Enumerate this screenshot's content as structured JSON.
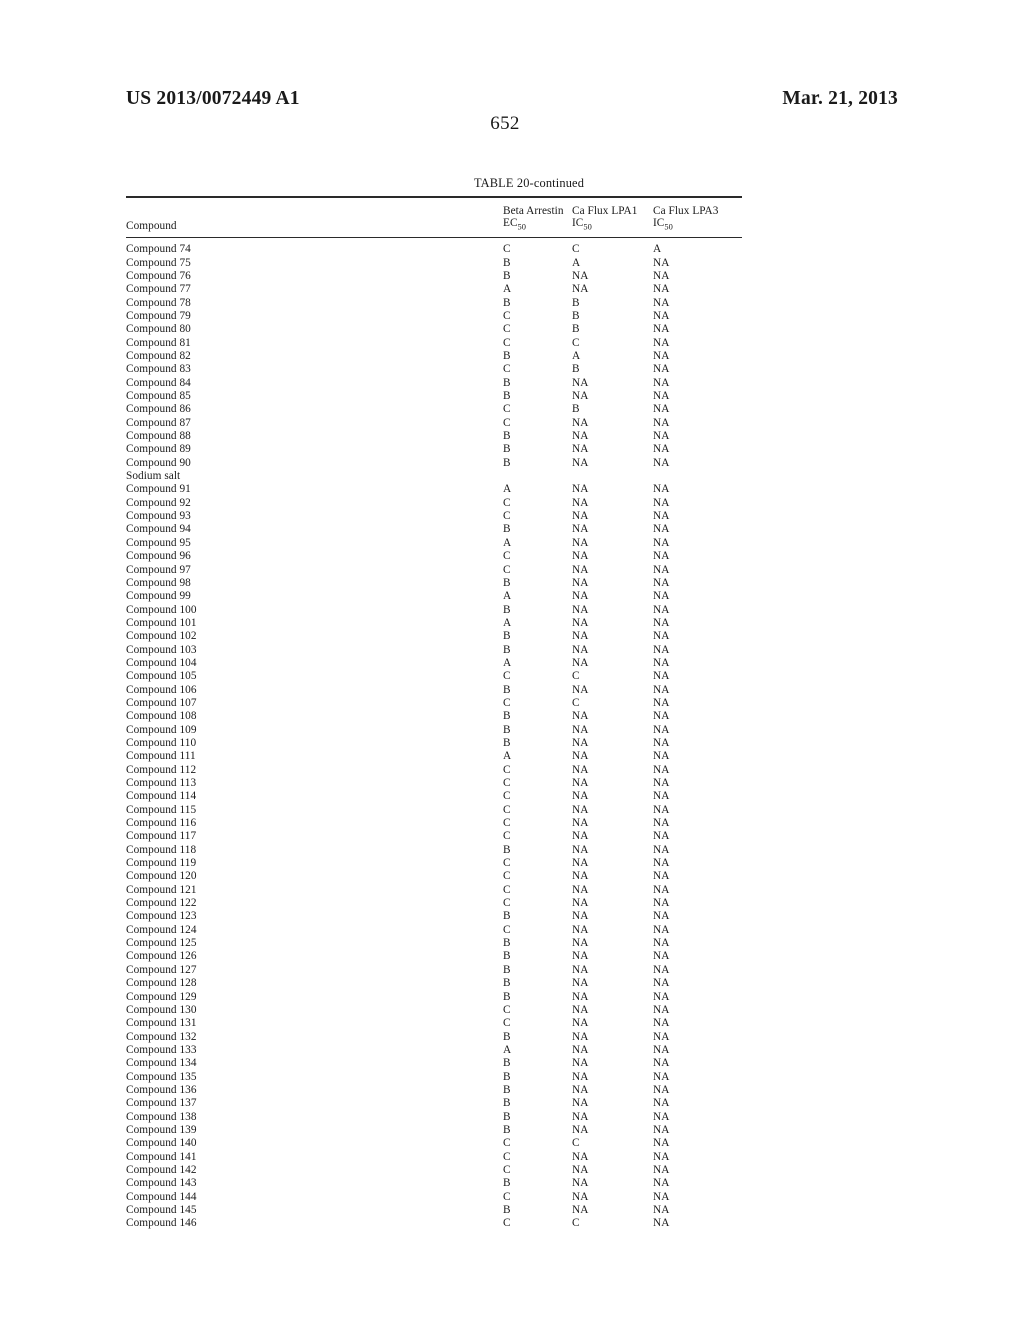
{
  "header": {
    "publication_number": "US 2013/0072449 A1",
    "publication_date": "Mar. 21, 2013",
    "page_number": "652"
  },
  "table": {
    "caption": "TABLE 20-continued",
    "columns": [
      {
        "line1": "Compound",
        "line2": ""
      },
      {
        "line1": "Beta Arrestin",
        "line2": "EC",
        "sub": "50"
      },
      {
        "line1": "Ca Flux LPA1",
        "line2": "IC",
        "sub": "50"
      },
      {
        "line1": "Ca Flux LPA3",
        "line2": "IC",
        "sub": "50"
      }
    ],
    "rows": [
      {
        "compound": "Compound 74",
        "beta_arrestin_ec50": "C",
        "ca_flux_lpa1_ic50": "C",
        "ca_flux_lpa3_ic50": "A"
      },
      {
        "compound": "Compound 75",
        "beta_arrestin_ec50": "B",
        "ca_flux_lpa1_ic50": "A",
        "ca_flux_lpa3_ic50": "NA"
      },
      {
        "compound": "Compound 76",
        "beta_arrestin_ec50": "B",
        "ca_flux_lpa1_ic50": "NA",
        "ca_flux_lpa3_ic50": "NA"
      },
      {
        "compound": "Compound 77",
        "beta_arrestin_ec50": "A",
        "ca_flux_lpa1_ic50": "NA",
        "ca_flux_lpa3_ic50": "NA"
      },
      {
        "compound": "Compound 78",
        "beta_arrestin_ec50": "B",
        "ca_flux_lpa1_ic50": "B",
        "ca_flux_lpa3_ic50": "NA"
      },
      {
        "compound": "Compound 79",
        "beta_arrestin_ec50": "C",
        "ca_flux_lpa1_ic50": "B",
        "ca_flux_lpa3_ic50": "NA"
      },
      {
        "compound": "Compound 80",
        "beta_arrestin_ec50": "C",
        "ca_flux_lpa1_ic50": "B",
        "ca_flux_lpa3_ic50": "NA"
      },
      {
        "compound": "Compound 81",
        "beta_arrestin_ec50": "C",
        "ca_flux_lpa1_ic50": "C",
        "ca_flux_lpa3_ic50": "NA"
      },
      {
        "compound": "Compound 82",
        "beta_arrestin_ec50": "B",
        "ca_flux_lpa1_ic50": "A",
        "ca_flux_lpa3_ic50": "NA"
      },
      {
        "compound": "Compound 83",
        "beta_arrestin_ec50": "C",
        "ca_flux_lpa1_ic50": "B",
        "ca_flux_lpa3_ic50": "NA"
      },
      {
        "compound": "Compound 84",
        "beta_arrestin_ec50": "B",
        "ca_flux_lpa1_ic50": "NA",
        "ca_flux_lpa3_ic50": "NA"
      },
      {
        "compound": "Compound 85",
        "beta_arrestin_ec50": "B",
        "ca_flux_lpa1_ic50": "NA",
        "ca_flux_lpa3_ic50": "NA"
      },
      {
        "compound": "Compound 86",
        "beta_arrestin_ec50": "C",
        "ca_flux_lpa1_ic50": "B",
        "ca_flux_lpa3_ic50": "NA"
      },
      {
        "compound": "Compound 87",
        "beta_arrestin_ec50": "C",
        "ca_flux_lpa1_ic50": "NA",
        "ca_flux_lpa3_ic50": "NA"
      },
      {
        "compound": "Compound 88",
        "beta_arrestin_ec50": "B",
        "ca_flux_lpa1_ic50": "NA",
        "ca_flux_lpa3_ic50": "NA"
      },
      {
        "compound": "Compound 89",
        "beta_arrestin_ec50": "B",
        "ca_flux_lpa1_ic50": "NA",
        "ca_flux_lpa3_ic50": "NA"
      },
      {
        "compound": "Compound 90",
        "beta_arrestin_ec50": "B",
        "ca_flux_lpa1_ic50": "NA",
        "ca_flux_lpa3_ic50": "NA"
      },
      {
        "compound": "Sodium salt",
        "beta_arrestin_ec50": "",
        "ca_flux_lpa1_ic50": "",
        "ca_flux_lpa3_ic50": ""
      },
      {
        "compound": "Compound 91",
        "beta_arrestin_ec50": "A",
        "ca_flux_lpa1_ic50": "NA",
        "ca_flux_lpa3_ic50": "NA"
      },
      {
        "compound": "Compound 92",
        "beta_arrestin_ec50": "C",
        "ca_flux_lpa1_ic50": "NA",
        "ca_flux_lpa3_ic50": "NA"
      },
      {
        "compound": "Compound 93",
        "beta_arrestin_ec50": "C",
        "ca_flux_lpa1_ic50": "NA",
        "ca_flux_lpa3_ic50": "NA"
      },
      {
        "compound": "Compound 94",
        "beta_arrestin_ec50": "B",
        "ca_flux_lpa1_ic50": "NA",
        "ca_flux_lpa3_ic50": "NA"
      },
      {
        "compound": "Compound 95",
        "beta_arrestin_ec50": "A",
        "ca_flux_lpa1_ic50": "NA",
        "ca_flux_lpa3_ic50": "NA"
      },
      {
        "compound": "Compound 96",
        "beta_arrestin_ec50": "C",
        "ca_flux_lpa1_ic50": "NA",
        "ca_flux_lpa3_ic50": "NA"
      },
      {
        "compound": "Compound 97",
        "beta_arrestin_ec50": "C",
        "ca_flux_lpa1_ic50": "NA",
        "ca_flux_lpa3_ic50": "NA"
      },
      {
        "compound": "Compound 98",
        "beta_arrestin_ec50": "B",
        "ca_flux_lpa1_ic50": "NA",
        "ca_flux_lpa3_ic50": "NA"
      },
      {
        "compound": "Compound 99",
        "beta_arrestin_ec50": "A",
        "ca_flux_lpa1_ic50": "NA",
        "ca_flux_lpa3_ic50": "NA"
      },
      {
        "compound": "Compound 100",
        "beta_arrestin_ec50": "B",
        "ca_flux_lpa1_ic50": "NA",
        "ca_flux_lpa3_ic50": "NA"
      },
      {
        "compound": "Compound 101",
        "beta_arrestin_ec50": "A",
        "ca_flux_lpa1_ic50": "NA",
        "ca_flux_lpa3_ic50": "NA"
      },
      {
        "compound": "Compound 102",
        "beta_arrestin_ec50": "B",
        "ca_flux_lpa1_ic50": "NA",
        "ca_flux_lpa3_ic50": "NA"
      },
      {
        "compound": "Compound 103",
        "beta_arrestin_ec50": "B",
        "ca_flux_lpa1_ic50": "NA",
        "ca_flux_lpa3_ic50": "NA"
      },
      {
        "compound": "Compound 104",
        "beta_arrestin_ec50": "A",
        "ca_flux_lpa1_ic50": "NA",
        "ca_flux_lpa3_ic50": "NA"
      },
      {
        "compound": "Compound 105",
        "beta_arrestin_ec50": "C",
        "ca_flux_lpa1_ic50": "C",
        "ca_flux_lpa3_ic50": "NA"
      },
      {
        "compound": "Compound 106",
        "beta_arrestin_ec50": "B",
        "ca_flux_lpa1_ic50": "NA",
        "ca_flux_lpa3_ic50": "NA"
      },
      {
        "compound": "Compound 107",
        "beta_arrestin_ec50": "C",
        "ca_flux_lpa1_ic50": "C",
        "ca_flux_lpa3_ic50": "NA"
      },
      {
        "compound": "Compound 108",
        "beta_arrestin_ec50": "B",
        "ca_flux_lpa1_ic50": "NA",
        "ca_flux_lpa3_ic50": "NA"
      },
      {
        "compound": "Compound 109",
        "beta_arrestin_ec50": "B",
        "ca_flux_lpa1_ic50": "NA",
        "ca_flux_lpa3_ic50": "NA"
      },
      {
        "compound": "Compound 110",
        "beta_arrestin_ec50": "B",
        "ca_flux_lpa1_ic50": "NA",
        "ca_flux_lpa3_ic50": "NA"
      },
      {
        "compound": "Compound 111",
        "beta_arrestin_ec50": "A",
        "ca_flux_lpa1_ic50": "NA",
        "ca_flux_lpa3_ic50": "NA"
      },
      {
        "compound": "Compound 112",
        "beta_arrestin_ec50": "C",
        "ca_flux_lpa1_ic50": "NA",
        "ca_flux_lpa3_ic50": "NA"
      },
      {
        "compound": "Compound 113",
        "beta_arrestin_ec50": "C",
        "ca_flux_lpa1_ic50": "NA",
        "ca_flux_lpa3_ic50": "NA"
      },
      {
        "compound": "Compound 114",
        "beta_arrestin_ec50": "C",
        "ca_flux_lpa1_ic50": "NA",
        "ca_flux_lpa3_ic50": "NA"
      },
      {
        "compound": "Compound 115",
        "beta_arrestin_ec50": "C",
        "ca_flux_lpa1_ic50": "NA",
        "ca_flux_lpa3_ic50": "NA"
      },
      {
        "compound": "Compound 116",
        "beta_arrestin_ec50": "C",
        "ca_flux_lpa1_ic50": "NA",
        "ca_flux_lpa3_ic50": "NA"
      },
      {
        "compound": "Compound 117",
        "beta_arrestin_ec50": "C",
        "ca_flux_lpa1_ic50": "NA",
        "ca_flux_lpa3_ic50": "NA"
      },
      {
        "compound": "Compound 118",
        "beta_arrestin_ec50": "B",
        "ca_flux_lpa1_ic50": "NA",
        "ca_flux_lpa3_ic50": "NA"
      },
      {
        "compound": "Compound 119",
        "beta_arrestin_ec50": "C",
        "ca_flux_lpa1_ic50": "NA",
        "ca_flux_lpa3_ic50": "NA"
      },
      {
        "compound": "Compound 120",
        "beta_arrestin_ec50": "C",
        "ca_flux_lpa1_ic50": "NA",
        "ca_flux_lpa3_ic50": "NA"
      },
      {
        "compound": "Compound 121",
        "beta_arrestin_ec50": "C",
        "ca_flux_lpa1_ic50": "NA",
        "ca_flux_lpa3_ic50": "NA"
      },
      {
        "compound": "Compound 122",
        "beta_arrestin_ec50": "C",
        "ca_flux_lpa1_ic50": "NA",
        "ca_flux_lpa3_ic50": "NA"
      },
      {
        "compound": "Compound 123",
        "beta_arrestin_ec50": "B",
        "ca_flux_lpa1_ic50": "NA",
        "ca_flux_lpa3_ic50": "NA"
      },
      {
        "compound": "Compound 124",
        "beta_arrestin_ec50": "C",
        "ca_flux_lpa1_ic50": "NA",
        "ca_flux_lpa3_ic50": "NA"
      },
      {
        "compound": "Compound 125",
        "beta_arrestin_ec50": "B",
        "ca_flux_lpa1_ic50": "NA",
        "ca_flux_lpa3_ic50": "NA"
      },
      {
        "compound": "Compound 126",
        "beta_arrestin_ec50": "B",
        "ca_flux_lpa1_ic50": "NA",
        "ca_flux_lpa3_ic50": "NA"
      },
      {
        "compound": "Compound 127",
        "beta_arrestin_ec50": "B",
        "ca_flux_lpa1_ic50": "NA",
        "ca_flux_lpa3_ic50": "NA"
      },
      {
        "compound": "Compound 128",
        "beta_arrestin_ec50": "B",
        "ca_flux_lpa1_ic50": "NA",
        "ca_flux_lpa3_ic50": "NA"
      },
      {
        "compound": "Compound 129",
        "beta_arrestin_ec50": "B",
        "ca_flux_lpa1_ic50": "NA",
        "ca_flux_lpa3_ic50": "NA"
      },
      {
        "compound": "Compound 130",
        "beta_arrestin_ec50": "C",
        "ca_flux_lpa1_ic50": "NA",
        "ca_flux_lpa3_ic50": "NA"
      },
      {
        "compound": "Compound 131",
        "beta_arrestin_ec50": "C",
        "ca_flux_lpa1_ic50": "NA",
        "ca_flux_lpa3_ic50": "NA"
      },
      {
        "compound": "Compound 132",
        "beta_arrestin_ec50": "B",
        "ca_flux_lpa1_ic50": "NA",
        "ca_flux_lpa3_ic50": "NA"
      },
      {
        "compound": "Compound 133",
        "beta_arrestin_ec50": "A",
        "ca_flux_lpa1_ic50": "NA",
        "ca_flux_lpa3_ic50": "NA"
      },
      {
        "compound": "Compound 134",
        "beta_arrestin_ec50": "B",
        "ca_flux_lpa1_ic50": "NA",
        "ca_flux_lpa3_ic50": "NA"
      },
      {
        "compound": "Compound 135",
        "beta_arrestin_ec50": "B",
        "ca_flux_lpa1_ic50": "NA",
        "ca_flux_lpa3_ic50": "NA"
      },
      {
        "compound": "Compound 136",
        "beta_arrestin_ec50": "B",
        "ca_flux_lpa1_ic50": "NA",
        "ca_flux_lpa3_ic50": "NA"
      },
      {
        "compound": "Compound 137",
        "beta_arrestin_ec50": "B",
        "ca_flux_lpa1_ic50": "NA",
        "ca_flux_lpa3_ic50": "NA"
      },
      {
        "compound": "Compound 138",
        "beta_arrestin_ec50": "B",
        "ca_flux_lpa1_ic50": "NA",
        "ca_flux_lpa3_ic50": "NA"
      },
      {
        "compound": "Compound 139",
        "beta_arrestin_ec50": "B",
        "ca_flux_lpa1_ic50": "NA",
        "ca_flux_lpa3_ic50": "NA"
      },
      {
        "compound": "Compound 140",
        "beta_arrestin_ec50": "C",
        "ca_flux_lpa1_ic50": "C",
        "ca_flux_lpa3_ic50": "NA"
      },
      {
        "compound": "Compound 141",
        "beta_arrestin_ec50": "C",
        "ca_flux_lpa1_ic50": "NA",
        "ca_flux_lpa3_ic50": "NA"
      },
      {
        "compound": "Compound 142",
        "beta_arrestin_ec50": "C",
        "ca_flux_lpa1_ic50": "NA",
        "ca_flux_lpa3_ic50": "NA"
      },
      {
        "compound": "Compound 143",
        "beta_arrestin_ec50": "B",
        "ca_flux_lpa1_ic50": "NA",
        "ca_flux_lpa3_ic50": "NA"
      },
      {
        "compound": "Compound 144",
        "beta_arrestin_ec50": "C",
        "ca_flux_lpa1_ic50": "NA",
        "ca_flux_lpa3_ic50": "NA"
      },
      {
        "compound": "Compound 145",
        "beta_arrestin_ec50": "B",
        "ca_flux_lpa1_ic50": "NA",
        "ca_flux_lpa3_ic50": "NA"
      },
      {
        "compound": "Compound 146",
        "beta_arrestin_ec50": "C",
        "ca_flux_lpa1_ic50": "C",
        "ca_flux_lpa3_ic50": "NA"
      }
    ]
  }
}
